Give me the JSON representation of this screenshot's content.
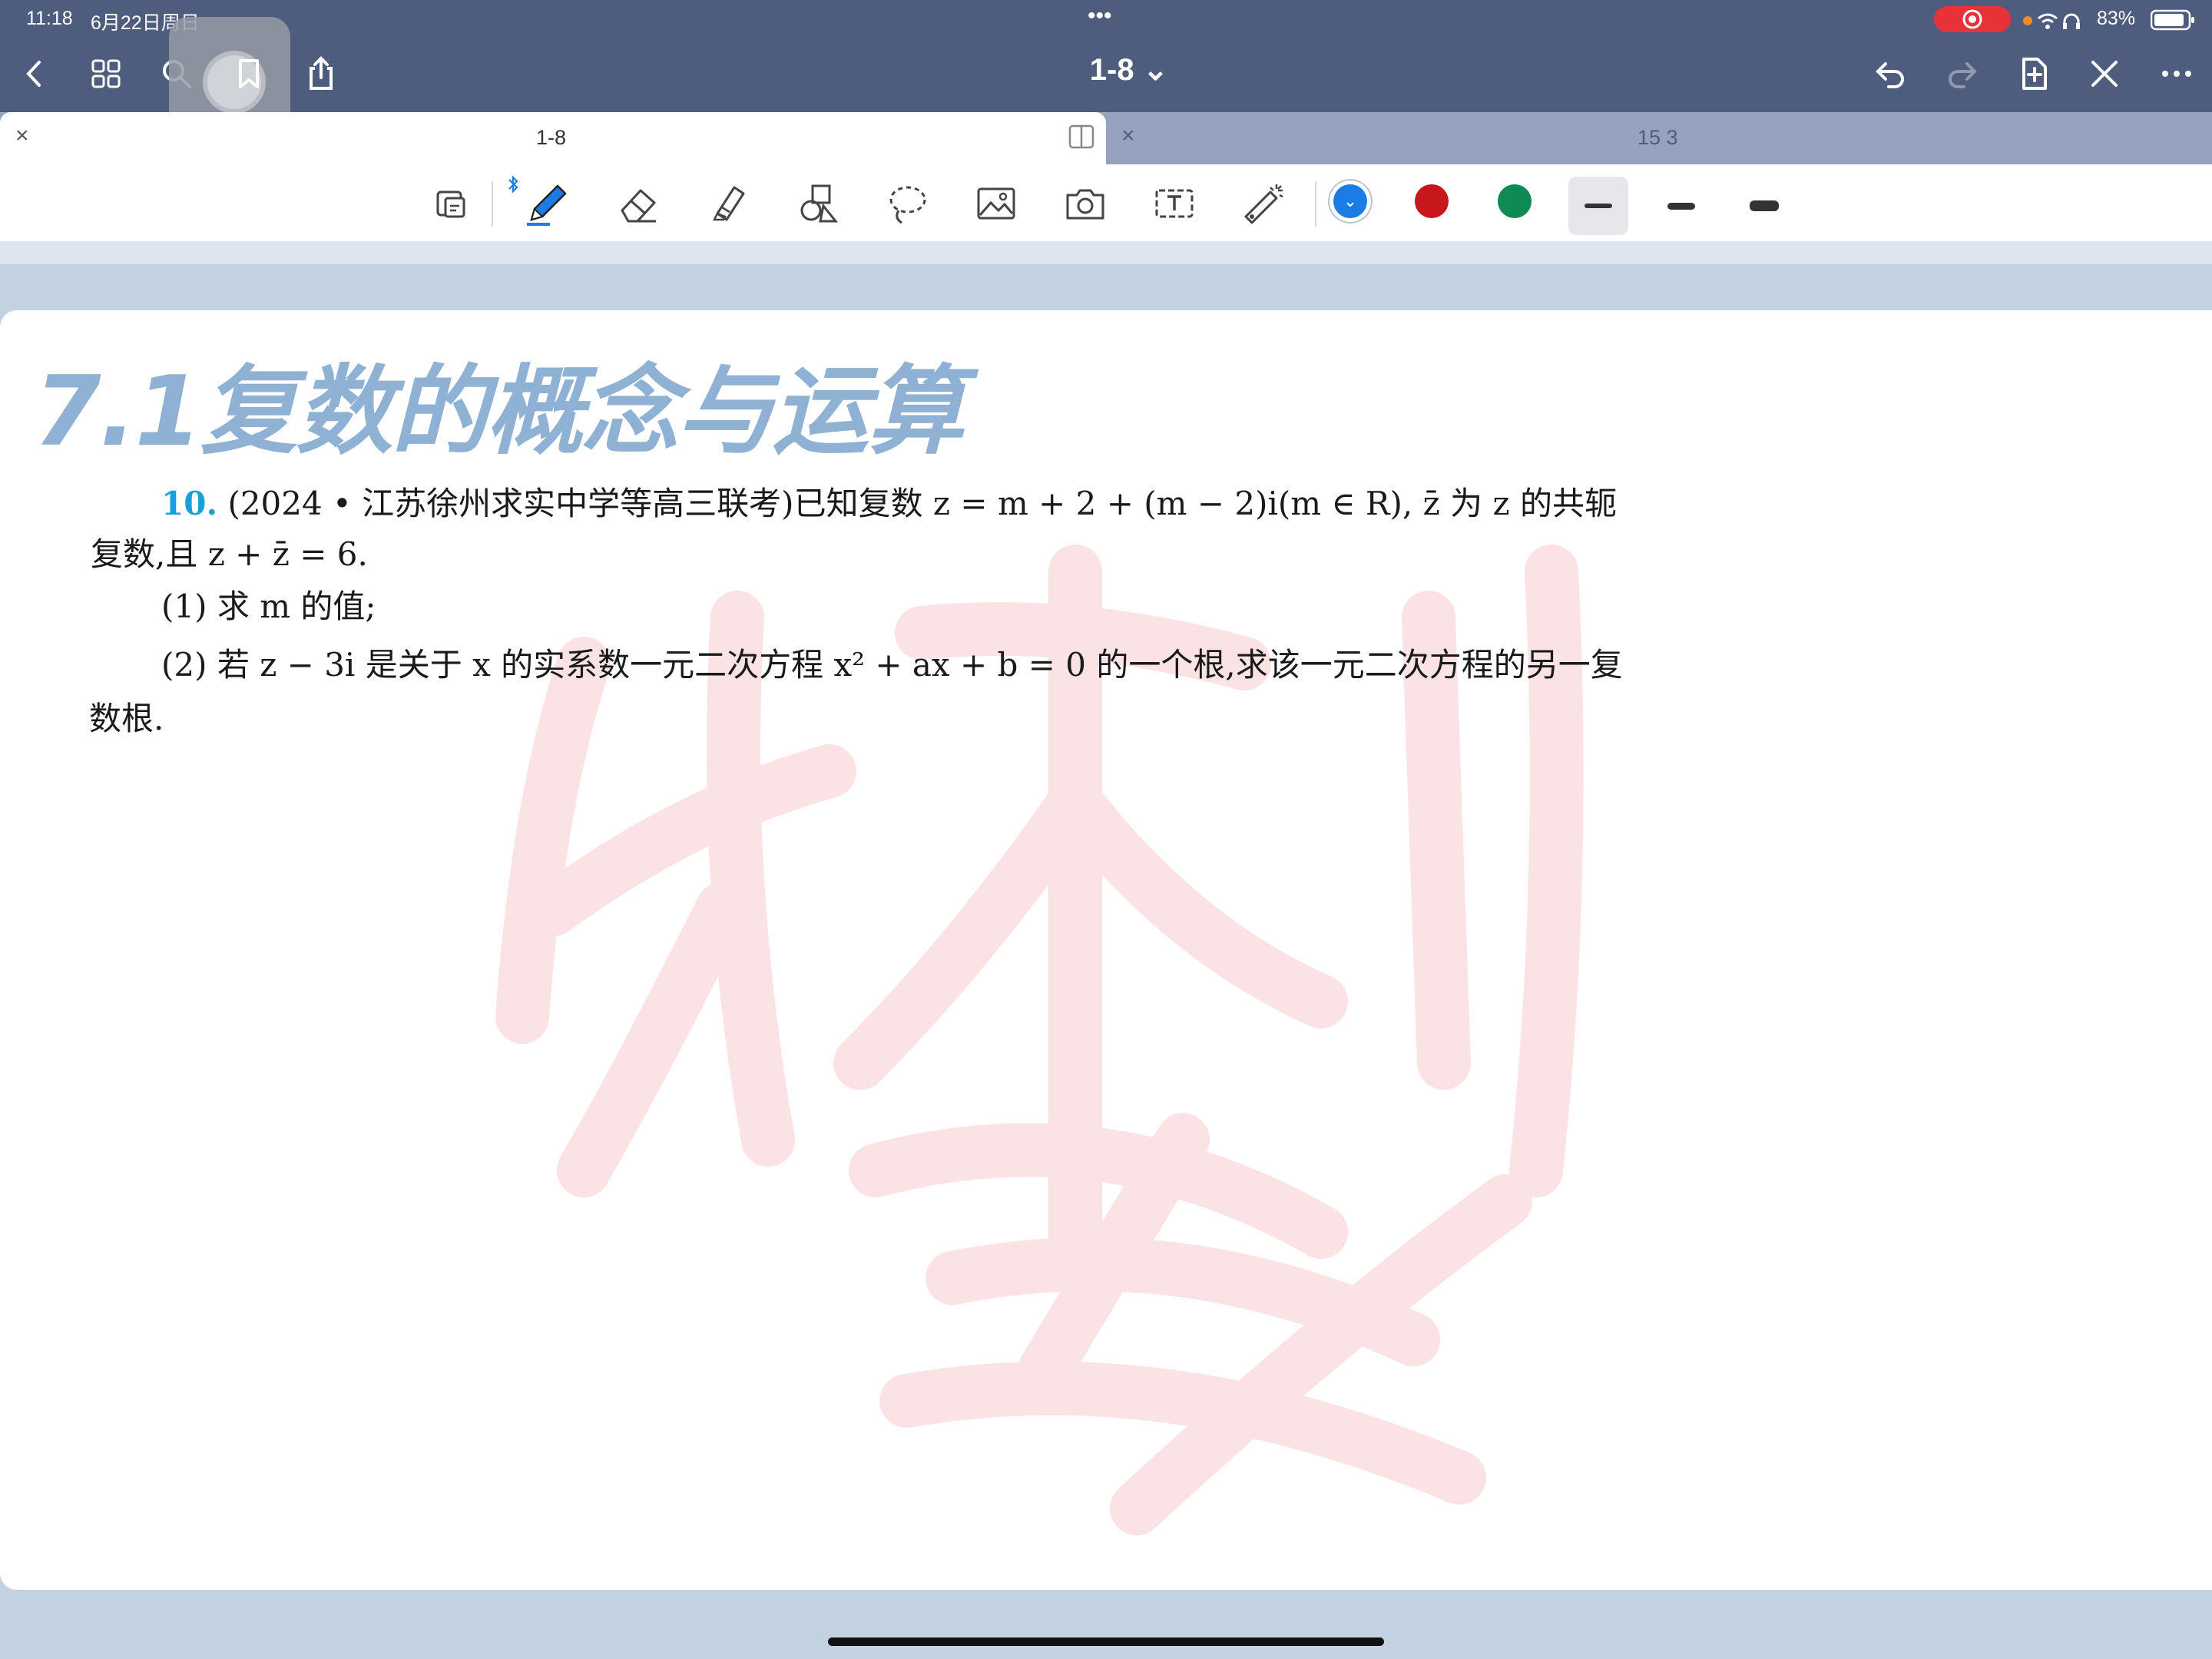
{
  "status": {
    "time": "11:18",
    "date": "6月22日周日",
    "battery": "83%",
    "dots": "•••"
  },
  "nav": {
    "doc_title": "1-8 ⌄"
  },
  "tabs": [
    {
      "label": "1-8",
      "close": "×"
    },
    {
      "label": "15 3",
      "close": "×"
    }
  ],
  "toolbar": {
    "colors": [
      "#1b7ce6",
      "#c8161d",
      "#0f8a55"
    ],
    "selected_color_mark": "⌄"
  },
  "page": {
    "chapter_title": "7.1复数的概念与运算",
    "problem_number": "10.",
    "line1": "(2024 • 江苏徐州求实中学等高三联考)已知复数 z = m + 2 + (m − 2)i(m ∈ R), z̄ 为 z 的共轭",
    "line2": "复数,且 z + z̄ = 6.",
    "line3": "(1) 求 m 的值;",
    "line4": "(2) 若 z − 3i 是关于 x 的实系数一元二次方程 x² + ax + b = 0 的一个根,求该一元二次方程的另一复",
    "line5": "数根."
  }
}
